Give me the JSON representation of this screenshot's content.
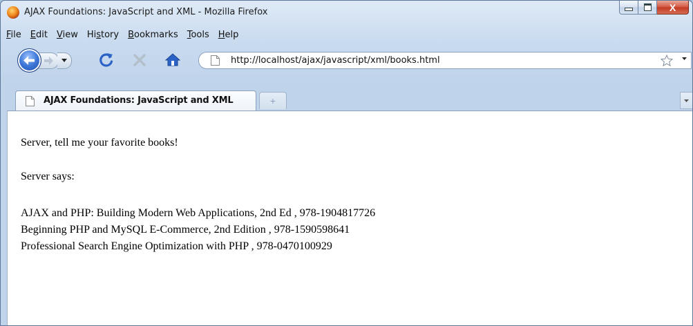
{
  "window": {
    "title": "AJAX Foundations: JavaScript and XML - Mozilla Firefox",
    "close_glyph": "X"
  },
  "menubar": {
    "items": [
      {
        "label": "File",
        "key": "F",
        "rest": "ile"
      },
      {
        "label": "Edit",
        "key": "E",
        "rest": "dit"
      },
      {
        "label": "View",
        "key": "V",
        "rest": "iew"
      },
      {
        "label": "History",
        "pre": "Hi",
        "key": "s",
        "rest": "tory"
      },
      {
        "label": "Bookmarks",
        "key": "B",
        "rest": "ookmarks"
      },
      {
        "label": "Tools",
        "key": "T",
        "rest": "ools"
      },
      {
        "label": "Help",
        "key": "H",
        "rest": "elp"
      }
    ]
  },
  "navbar": {
    "url": "http://localhost/ajax/javascript/xml/books.html",
    "icons": [
      "back-icon",
      "forward-icon",
      "history-dropdown-icon",
      "reload-icon",
      "stop-icon",
      "home-icon",
      "page-icon",
      "bookmark-star-icon",
      "url-dropdown-icon"
    ]
  },
  "tabs": {
    "active_label": "AJAX Foundations: JavaScript and XML",
    "new_tab_glyph": "+"
  },
  "page": {
    "prompt": "Server, tell me your favorite books!",
    "server_says": "Server says:",
    "books": [
      "AJAX and PHP: Building Modern Web Applications, 2nd Ed , 978-1904817726",
      "Beginning PHP and MySQL E-Commerce, 2nd Edition , 978-1590598641",
      "Professional Search Engine Optimization with PHP , 978-0470100929"
    ]
  },
  "colors": {
    "chrome": "#c9dbef",
    "close_button": "#c23a22",
    "reload": "#2b62c6",
    "home": "#2b62c6"
  }
}
